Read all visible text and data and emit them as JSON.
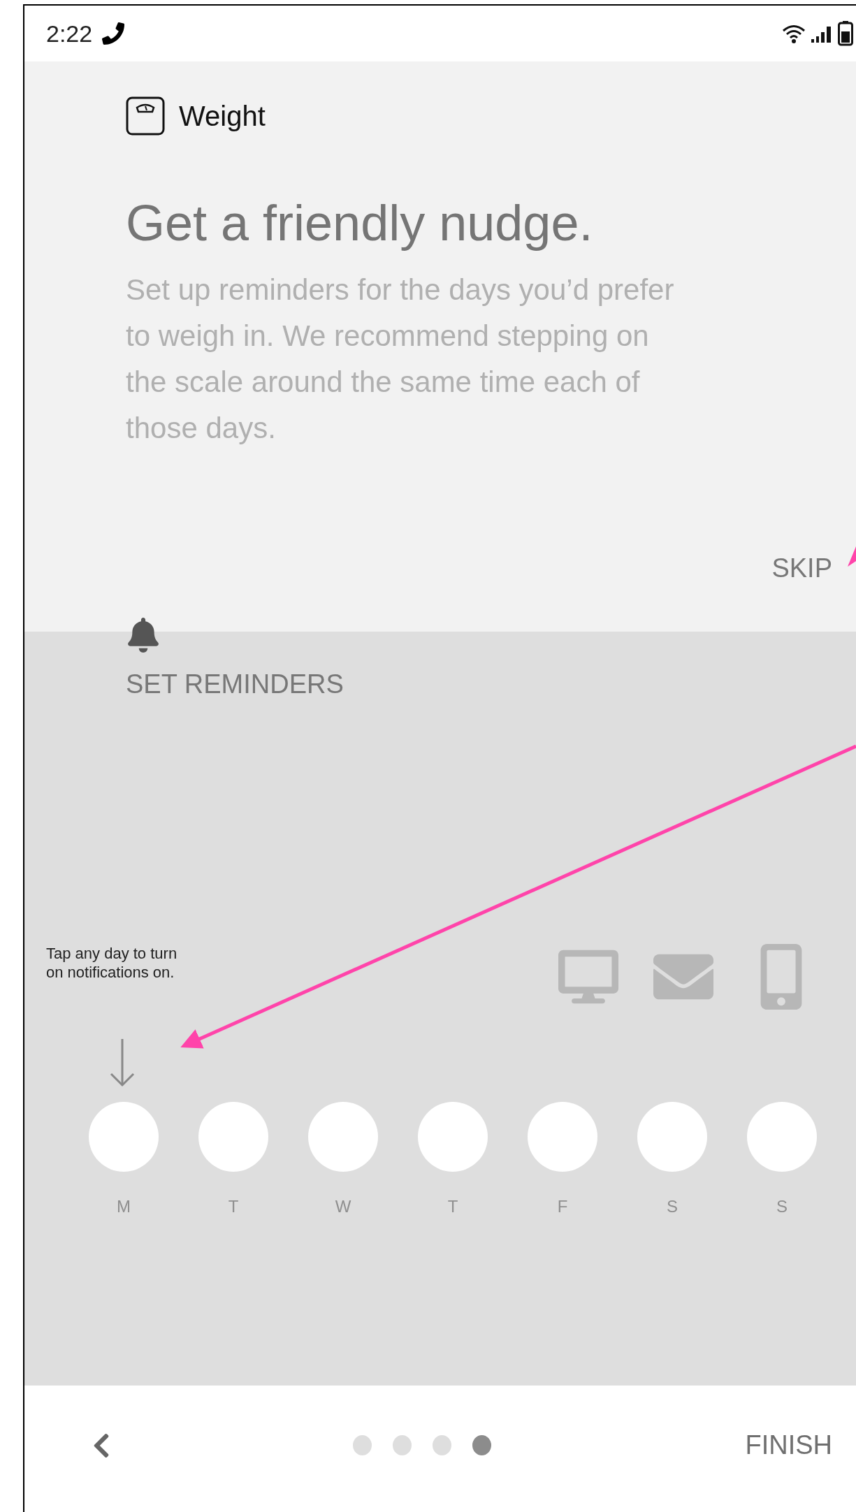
{
  "status_bar": {
    "time": "2:22"
  },
  "header": {
    "title": "Weight"
  },
  "intro": {
    "heading": "Get a friendly nudge.",
    "body": "Set up reminders for the days you’d prefer to weigh in. We recommend stepping on the scale around the same time each of those days.",
    "skip": "SKIP"
  },
  "reminders": {
    "title": "SET REMINDERS",
    "hint": "Tap any day to turn on notifications on.",
    "days": [
      {
        "label": "M",
        "selected": false
      },
      {
        "label": "T",
        "selected": false
      },
      {
        "label": "W",
        "selected": false
      },
      {
        "label": "T",
        "selected": false
      },
      {
        "label": "F",
        "selected": false
      },
      {
        "label": "S",
        "selected": false
      },
      {
        "label": "S",
        "selected": false
      }
    ]
  },
  "footer": {
    "pages": [
      {
        "selected": false
      },
      {
        "selected": false
      },
      {
        "selected": false
      },
      {
        "selected": true
      }
    ],
    "finish": "FINISH"
  }
}
